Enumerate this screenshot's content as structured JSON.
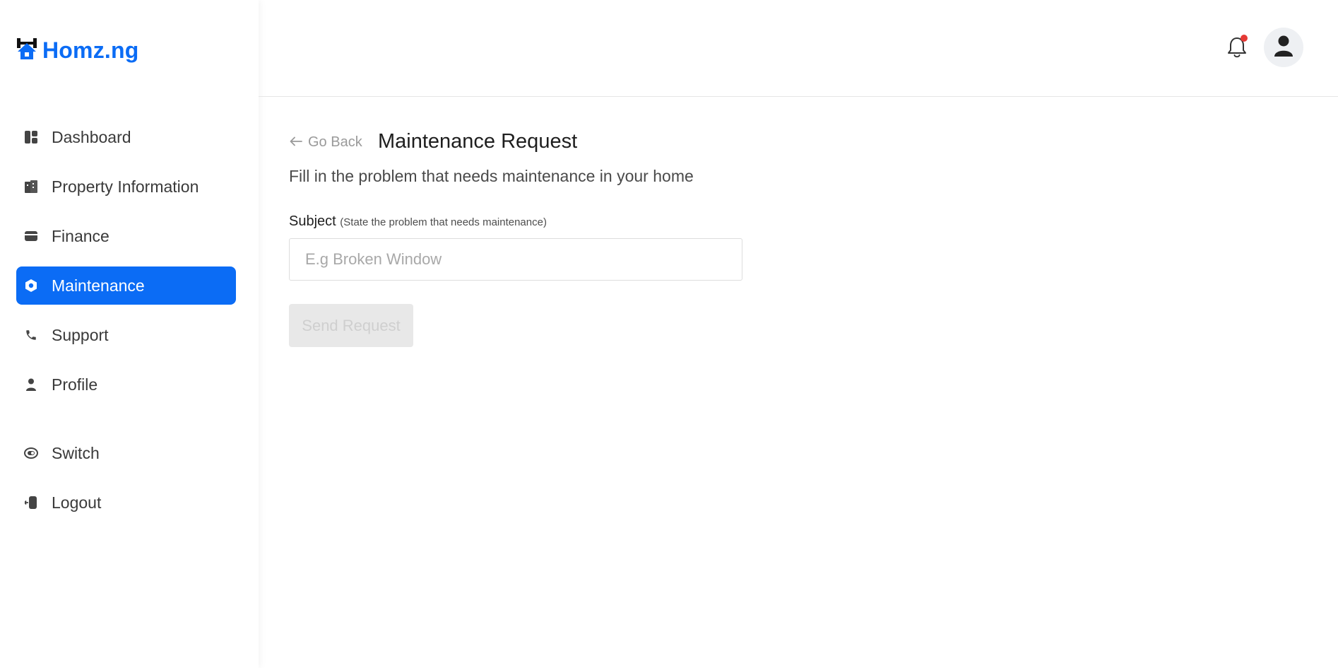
{
  "app": {
    "logo_text": "Homz.ng",
    "brand_color": "#0b6cf5"
  },
  "sidebar": {
    "items": [
      {
        "label": "Dashboard",
        "icon": "dashboard-icon",
        "active": false
      },
      {
        "label": "Property Information",
        "icon": "building-icon",
        "active": false
      },
      {
        "label": "Finance",
        "icon": "wallet-icon",
        "active": false
      },
      {
        "label": "Maintenance",
        "icon": "settings-nut-icon",
        "active": true
      },
      {
        "label": "Support",
        "icon": "phone-icon",
        "active": false
      },
      {
        "label": "Profile",
        "icon": "user-icon",
        "active": false
      },
      {
        "label": "Switch",
        "icon": "switch-icon",
        "active": false
      },
      {
        "label": "Logout",
        "icon": "logout-icon",
        "active": false
      }
    ]
  },
  "header": {
    "notifications_icon": "bell-icon",
    "has_unread": true,
    "avatar_icon": "user-avatar-icon"
  },
  "main": {
    "back_label": "Go Back",
    "title": "Maintenance Request",
    "subtitle": "Fill in the problem that needs maintenance in your home",
    "subject_label": "Subject",
    "subject_hint": "(State the problem that needs maintenance)",
    "subject_placeholder": "E.g Broken Window",
    "subject_value": "",
    "submit_label": "Send Request",
    "submit_disabled": true
  }
}
